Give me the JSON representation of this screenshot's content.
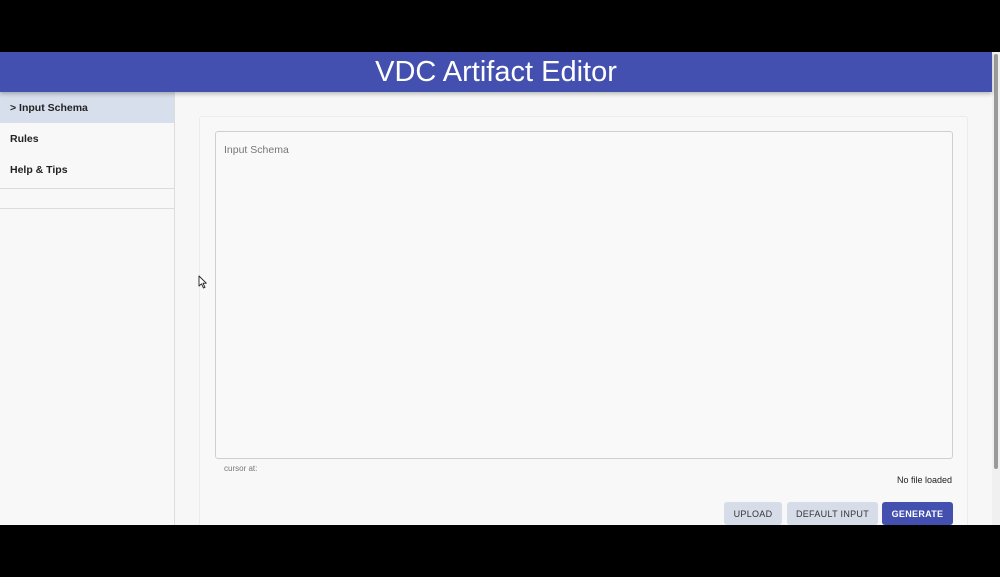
{
  "header": {
    "title": "VDC Artifact Editor"
  },
  "sidebar": {
    "items": [
      {
        "label": "> Input Schema",
        "active": true
      },
      {
        "label": "Rules",
        "active": false
      },
      {
        "label": "Help & Tips",
        "active": false
      }
    ]
  },
  "editor": {
    "placeholder": "Input Schema",
    "value": "",
    "cursor_label": "cursor at:",
    "file_status": "No file loaded"
  },
  "actions": {
    "upload_label": "Upload",
    "default_label": "Default Input",
    "generate_label": "Generate"
  },
  "colors": {
    "accent": "#4350b0",
    "secondary_button": "#d6dde9",
    "active_nav": "#d7dfec"
  }
}
